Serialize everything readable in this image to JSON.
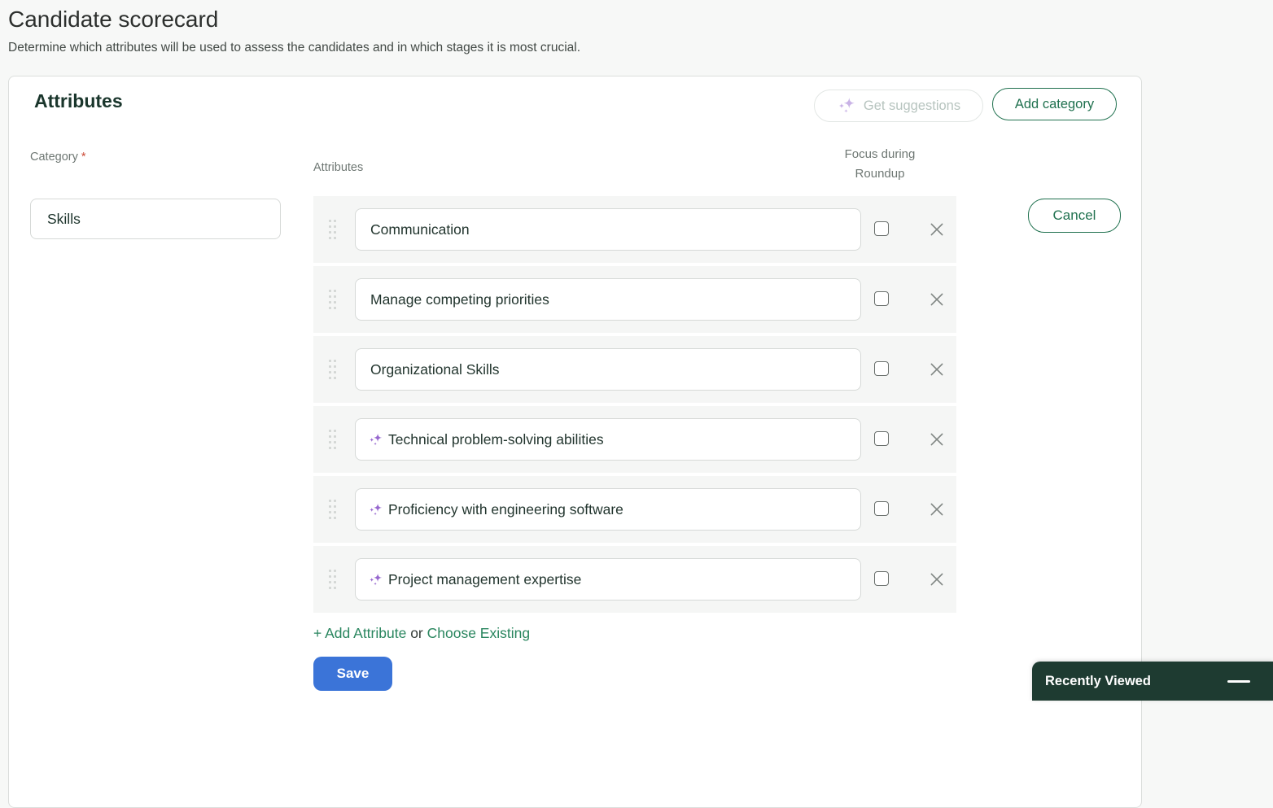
{
  "page": {
    "title": "Candidate scorecard",
    "subtitle": "Determine which attributes will be used to assess the candidates and in which stages it is most crucial."
  },
  "panel": {
    "heading": "Attributes",
    "get_suggestions_label": "Get suggestions",
    "add_category_label": "Add category",
    "category_label": "Category",
    "required_asterisk": "*",
    "category_value": "Skills",
    "attributes_column_label": "Attributes",
    "focus_column_label_line1": "Focus during",
    "focus_column_label_line2": "Roundup",
    "cancel_label": "Cancel",
    "add_attribute_link": "+ Add Attribute",
    "or_text": " or ",
    "choose_existing_link": "Choose Existing",
    "save_label": "Save"
  },
  "attributes": [
    {
      "name": "Communication",
      "ai_suggested": false,
      "focus_checked": false
    },
    {
      "name": "Manage competing priorities",
      "ai_suggested": false,
      "focus_checked": false
    },
    {
      "name": "Organizational Skills",
      "ai_suggested": false,
      "focus_checked": false
    },
    {
      "name": "Technical problem-solving abilities",
      "ai_suggested": true,
      "focus_checked": false
    },
    {
      "name": "Proficiency with engineering software",
      "ai_suggested": true,
      "focus_checked": false
    },
    {
      "name": "Project management expertise",
      "ai_suggested": true,
      "focus_checked": false
    }
  ],
  "recently_viewed": {
    "label": "Recently Viewed"
  },
  "icons": {
    "sparkles": "ai-sparkles-icon",
    "drag": "drag-handle-icon",
    "remove": "close-x-icon",
    "minimize": "minimize-dash-icon"
  },
  "colors": {
    "accent_green": "#20714f",
    "link_green": "#2a865f",
    "save_blue": "#3b74d8",
    "ai_purple": "#9768cf",
    "ai_purple_disabled": "#c9b3e6",
    "panel_dark_green": "#1e3b31",
    "row_bg": "#f5f6f5",
    "required_red": "#cc4b37"
  }
}
